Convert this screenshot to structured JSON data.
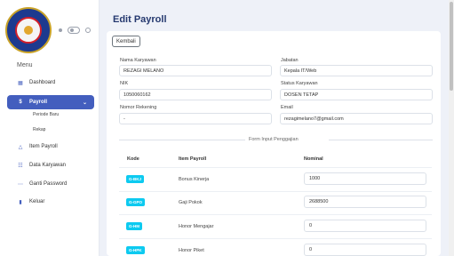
{
  "sidebar": {
    "menu_title": "Menu",
    "items": [
      {
        "label": "Dashboard",
        "icon": "grid-icon"
      },
      {
        "label": "Payroll",
        "icon": "dollar-icon"
      },
      {
        "label": "Item Payroll",
        "icon": "tag-icon"
      },
      {
        "label": "Data Karyawan",
        "icon": "users-icon"
      },
      {
        "label": "Ganti Password",
        "icon": "key-icon"
      },
      {
        "label": "Keluar",
        "icon": "logout-icon"
      }
    ],
    "sub_items": [
      {
        "label": "Periode Baru"
      },
      {
        "label": "Rekap"
      }
    ]
  },
  "page": {
    "title": "Edit Payroll",
    "back_label": "Kembali"
  },
  "form": {
    "nama_label": "Nama Karyawan",
    "nama_value": "REZAGI MELANO",
    "jabatan_label": "Jabatan",
    "jabatan_value": "Kepala IT/Web",
    "nik_label": "NIK",
    "nik_value": "1050060162",
    "status_label": "Status Karyawan",
    "status_value": "DOSEN TETAP",
    "rekening_label": "Nomor Rekening",
    "rekening_value": "-",
    "email_label": "Email",
    "email_value": "rezagimelano7@gmail.com",
    "section_title": "Form Input Penggajian"
  },
  "table": {
    "headers": [
      "Kode",
      "Item Payroll",
      "Nominal"
    ],
    "rows": [
      {
        "code": "G-BKJ",
        "name": "Bonus Kinerja",
        "value": "1000"
      },
      {
        "code": "G-GPO",
        "name": "Gaji Pokok",
        "value": "2688500"
      },
      {
        "code": "G-HM",
        "name": "Honor Mengajar",
        "value": "0"
      },
      {
        "code": "G-HPK",
        "name": "Honor Piket",
        "value": "0"
      }
    ]
  },
  "colors": {
    "primary": "#435ebe",
    "badge": "#0dcaf0",
    "title": "#25396f"
  }
}
